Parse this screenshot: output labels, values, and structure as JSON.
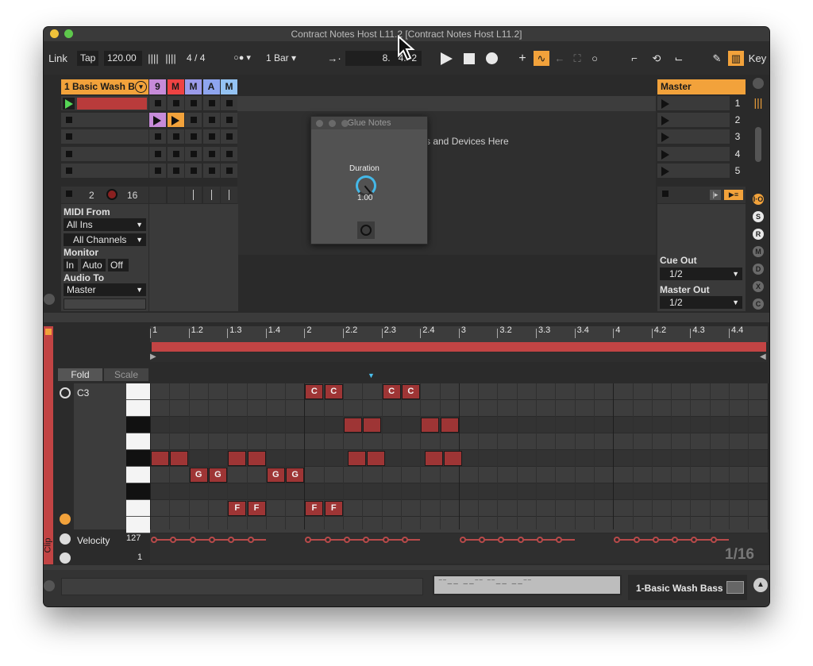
{
  "window": {
    "title": "Contract Notes Host L11.2 [Contract Notes Host L11.2]"
  },
  "transport": {
    "link": "Link",
    "tap": "Tap",
    "tempo": "120.00",
    "time_sig_num": "4",
    "time_sig_sep": "/",
    "time_sig_den": "4",
    "quantize": "1 Bar",
    "position_bar": "8.",
    "position_beat": "4",
    "position_sixteenth": "2",
    "key_label": "Key"
  },
  "tracks": {
    "clip_track_name": "1 Basic Wash B",
    "short_tracks": [
      "9",
      "M",
      "M",
      "A",
      "M"
    ],
    "short_track_colors": [
      "#c78bd9",
      "#ee4343",
      "#9b9bea",
      "#8ea5ef",
      "#94c3f3"
    ],
    "master_label": "Master",
    "scene_numbers": [
      "1",
      "2",
      "3",
      "4",
      "5"
    ]
  },
  "io": {
    "track_number": "2",
    "midi_count": "16",
    "midi_from_label": "MIDI From",
    "midi_from_value": "All Ins",
    "channel_value": "All Channels",
    "monitor_label": "Monitor",
    "monitor_in": "In",
    "monitor_auto": "Auto",
    "monitor_off": "Off",
    "audio_to_label": "Audio To",
    "audio_to_value": "Master",
    "cue_out_label": "Cue Out",
    "cue_out_value": "1/2",
    "master_out_label": "Master Out",
    "master_out_value": "1/2"
  },
  "drop_hint": "s and Devices Here",
  "plugin": {
    "title": "Glue Notes",
    "param_label": "Duration",
    "param_value": "1.00"
  },
  "sidebar_icons": [
    "I·O",
    "S",
    "R",
    "M",
    "D",
    "X",
    "C"
  ],
  "clip": {
    "ruler": [
      "1",
      "1.2",
      "1.3",
      "1.4",
      "2",
      "2.2",
      "2.3",
      "2.4",
      "3",
      "3.2",
      "3.3",
      "3.4",
      "4",
      "4.2",
      "4.3",
      "4.4"
    ],
    "fold": "Fold",
    "scale": "Scale",
    "pitch_label": "C3",
    "velocity_label": "Velocity",
    "velocity_max": "127",
    "velocity_min": "1",
    "grid": "1/16",
    "side_label": "Clip",
    "notes": [
      {
        "label": "C",
        "row": 0,
        "beat": 8
      },
      {
        "label": "C",
        "row": 0,
        "beat": 9
      },
      {
        "label": "C",
        "row": 0,
        "beat": 12
      },
      {
        "label": "C",
        "row": 0,
        "beat": 13
      },
      {
        "label": "",
        "row": 2,
        "beat": 10
      },
      {
        "label": "",
        "row": 2,
        "beat": 11
      },
      {
        "label": "",
        "row": 2,
        "beat": 14
      },
      {
        "label": "",
        "row": 2,
        "beat": 15
      },
      {
        "label": "",
        "row": 4,
        "beat": 0
      },
      {
        "label": "",
        "row": 4,
        "beat": 1
      },
      {
        "label": "",
        "row": 4,
        "beat": 4
      },
      {
        "label": "",
        "row": 4,
        "beat": 5
      },
      {
        "label": "",
        "row": 4,
        "beat": 10.2
      },
      {
        "label": "",
        "row": 4,
        "beat": 11.2
      },
      {
        "label": "",
        "row": 4,
        "beat": 14.2
      },
      {
        "label": "",
        "row": 4,
        "beat": 15.2
      },
      {
        "label": "G",
        "row": 5,
        "beat": 2
      },
      {
        "label": "G",
        "row": 5,
        "beat": 3
      },
      {
        "label": "G",
        "row": 5,
        "beat": 6
      },
      {
        "label": "G",
        "row": 5,
        "beat": 7
      },
      {
        "label": "F",
        "row": 7,
        "beat": 4
      },
      {
        "label": "F",
        "row": 7,
        "beat": 5
      },
      {
        "label": "F",
        "row": 7,
        "beat": 8
      },
      {
        "label": "F",
        "row": 7,
        "beat": 9
      }
    ]
  },
  "status": {
    "device_name": "1-Basic Wash Bass"
  }
}
